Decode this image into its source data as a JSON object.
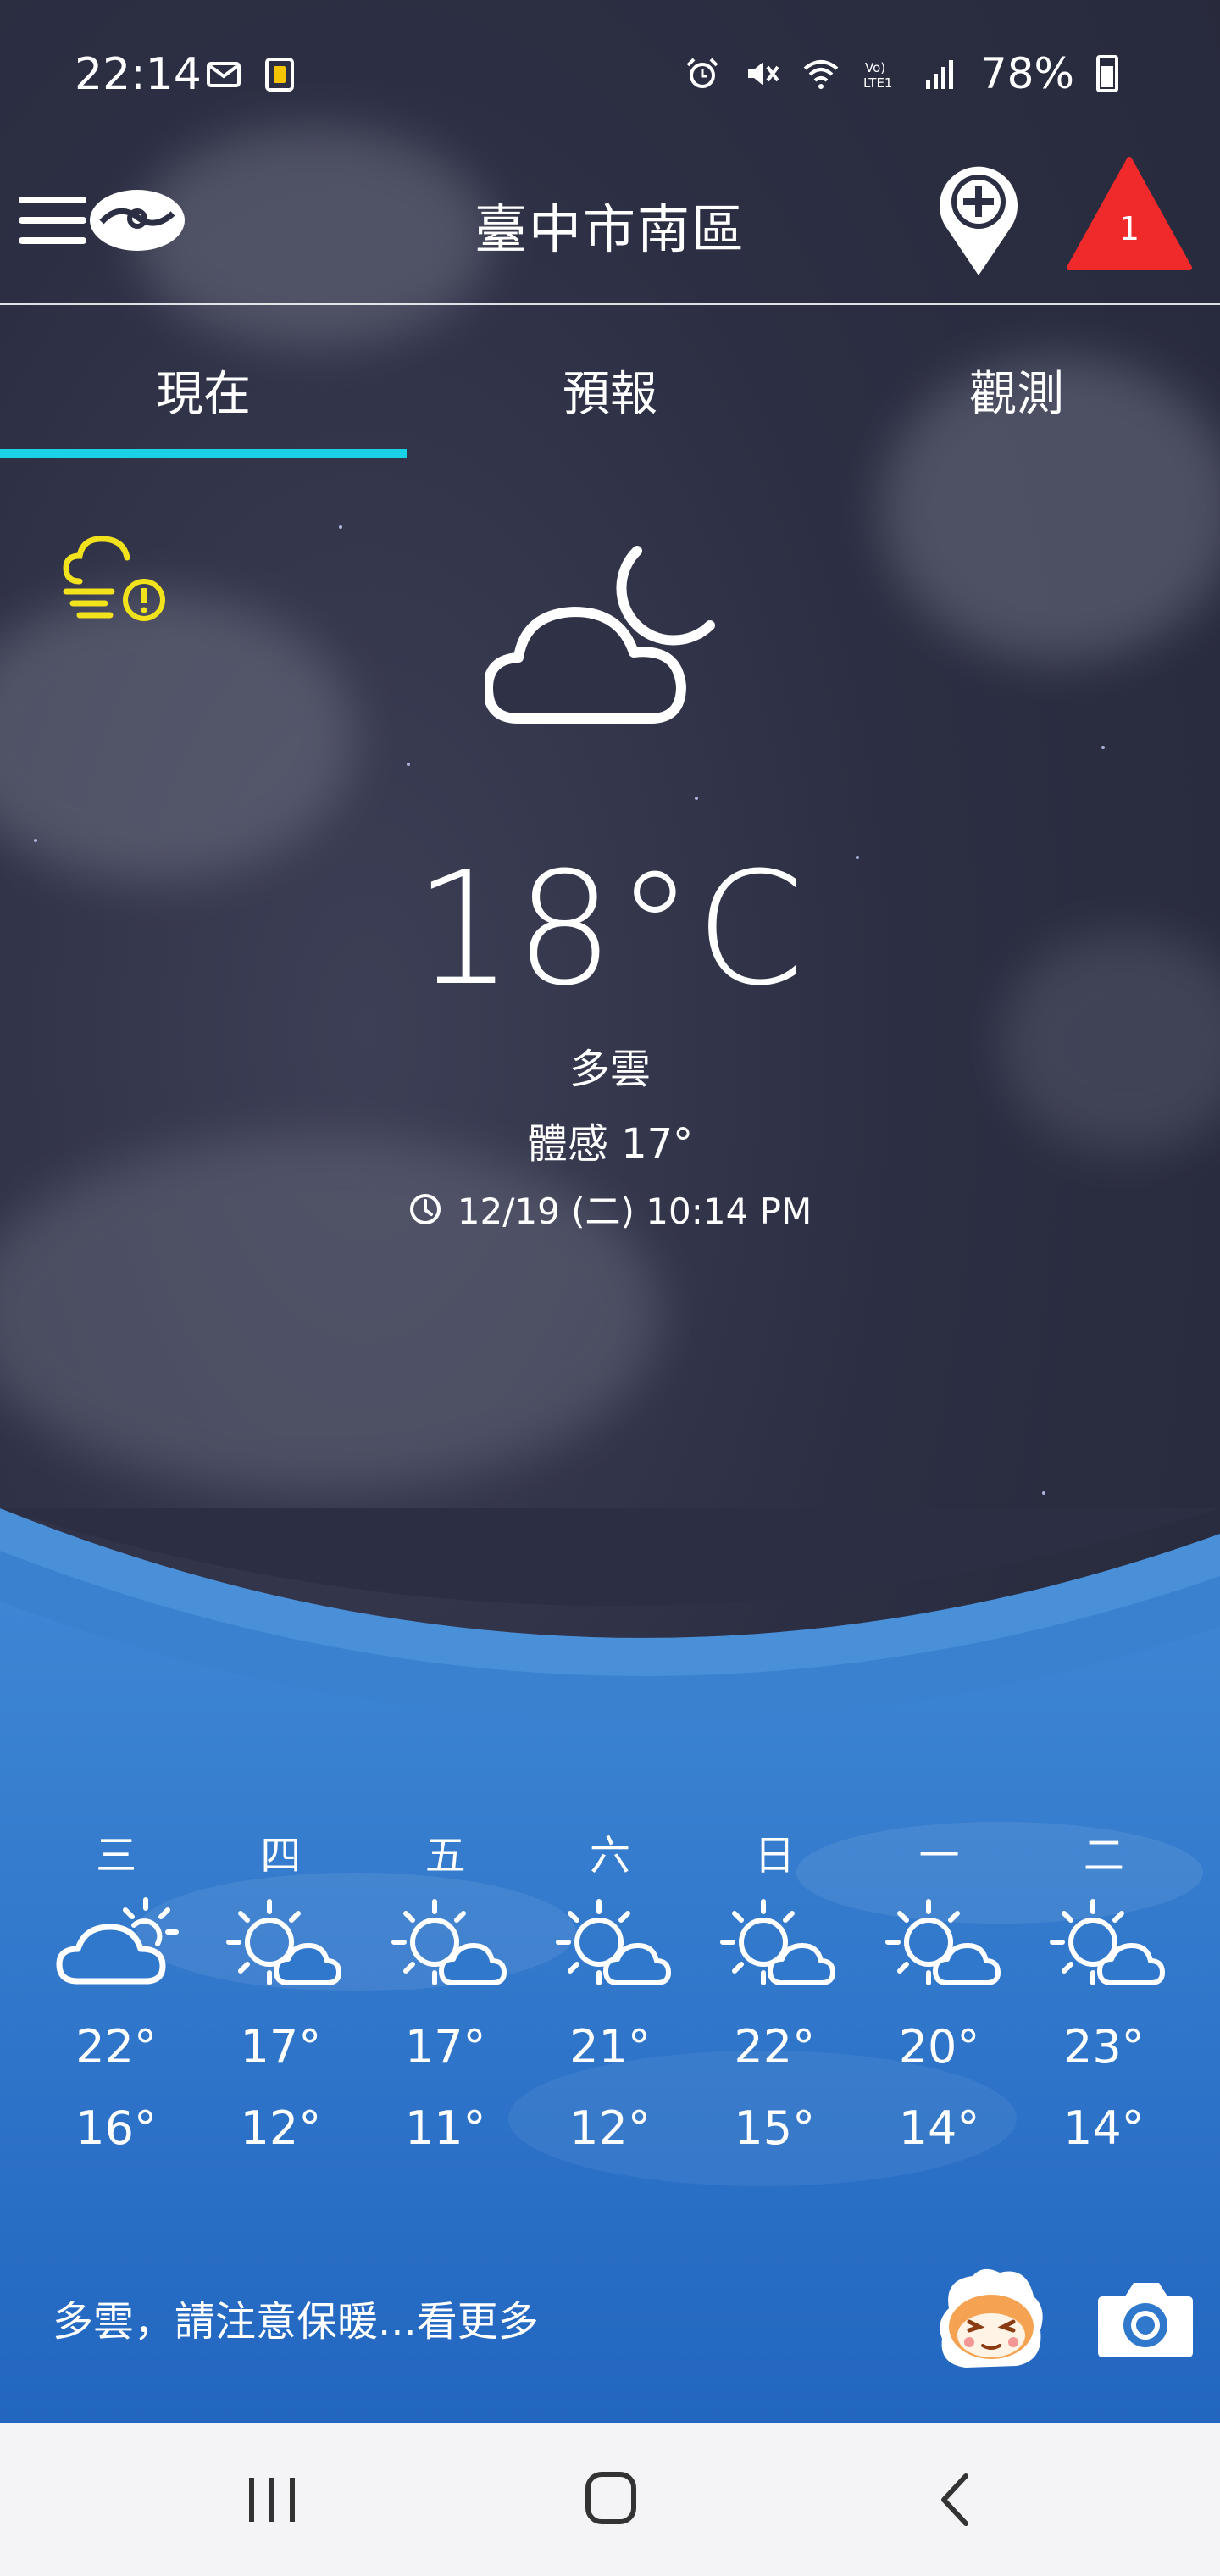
{
  "status_bar": {
    "time": "22:14",
    "battery_percent": "78%",
    "icons": [
      "mail-icon",
      "battery-app-icon",
      "alarm-icon",
      "mute-icon",
      "wifi-icon",
      "volte-icon",
      "signal-icon",
      "battery-icon"
    ]
  },
  "header": {
    "location": "臺中市南區",
    "alert_count": "1"
  },
  "tabs": [
    {
      "label": "現在",
      "active": true
    },
    {
      "label": "預報",
      "active": false
    },
    {
      "label": "觀測",
      "active": false
    }
  ],
  "current": {
    "temperature": "18°C",
    "condition": "多雲",
    "feels_like": "體感 17°",
    "observed_at": "12/19 (二) 10:14 PM",
    "icon": "cloud-moon-icon",
    "warning_icon": "wind-warning-icon"
  },
  "forecast": [
    {
      "day": "三",
      "hi": "22°",
      "lo": "16°",
      "icon": "cloud-sun-icon"
    },
    {
      "day": "四",
      "hi": "17°",
      "lo": "12°",
      "icon": "sun-cloud-icon"
    },
    {
      "day": "五",
      "hi": "17°",
      "lo": "11°",
      "icon": "sun-cloud-icon"
    },
    {
      "day": "六",
      "hi": "21°",
      "lo": "12°",
      "icon": "sun-cloud-icon"
    },
    {
      "day": "日",
      "hi": "22°",
      "lo": "15°",
      "icon": "sun-cloud-icon"
    },
    {
      "day": "一",
      "hi": "20°",
      "lo": "14°",
      "icon": "sun-cloud-icon"
    },
    {
      "day": "二",
      "hi": "23°",
      "lo": "14°",
      "icon": "sun-cloud-icon"
    }
  ],
  "summary_text": "多雲，請注意保暖...看更多",
  "colors": {
    "tab_indicator": "#19d2e6",
    "alert_red": "#f02a2a",
    "warning_yellow": "#f2e21c",
    "panel_blue": "#2f78cc"
  }
}
